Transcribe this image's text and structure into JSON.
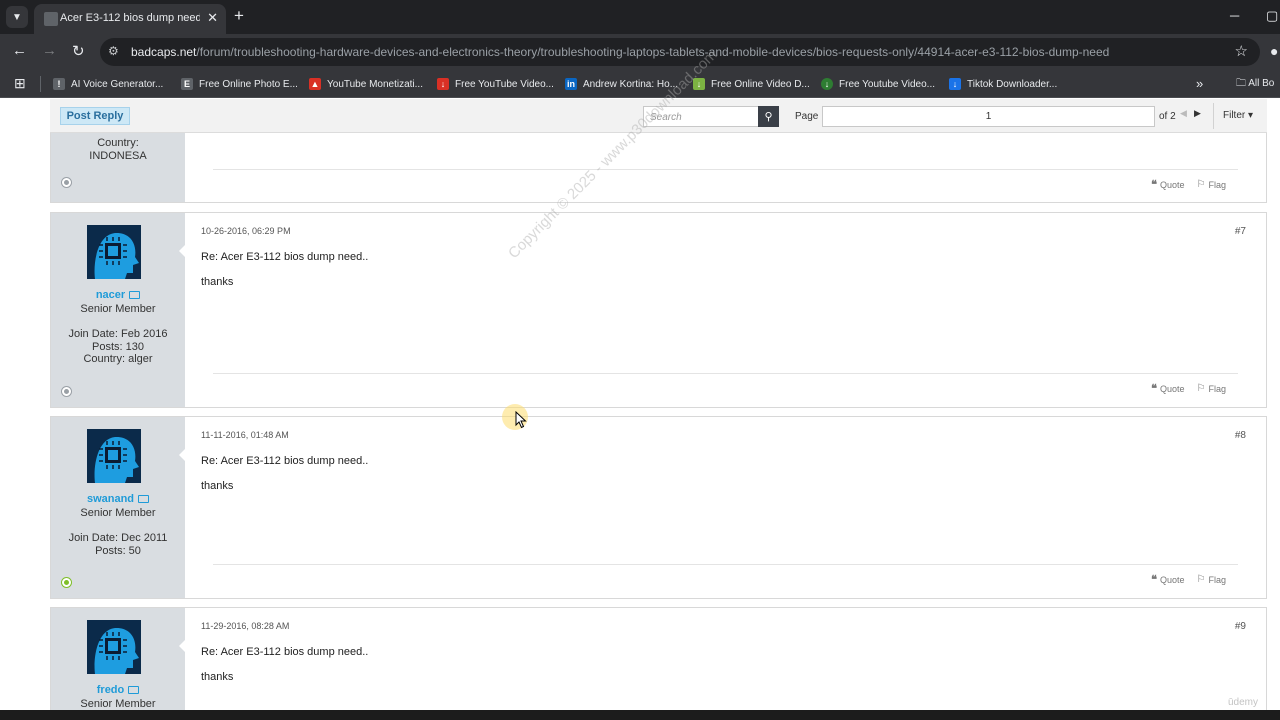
{
  "browser": {
    "tab": {
      "title": "Acer E3-112 bios dump need.."
    },
    "url": {
      "host": "badcaps.net",
      "path": "/forum/troubleshooting-hardware-devices-and-electronics-theory/troubleshooting-laptops-tablets-and-mobile-devices/bios-requests-only/44914-acer-e3-112-bios-dump-need"
    },
    "bookmarks": [
      {
        "label": "AI Voice Generator...",
        "icon": "ai-voice-icon",
        "color": "#5f6368"
      },
      {
        "label": "Free Online Photo E...",
        "icon": "photo-editor-icon",
        "color": "#5f6368"
      },
      {
        "label": "YouTube Monetizati...",
        "icon": "youtube-monetization-icon",
        "color": "#d93025"
      },
      {
        "label": "Free YouTube Video...",
        "icon": "youtube-download-icon",
        "color": "#d93025"
      },
      {
        "label": "Andrew Kortina: Ho...",
        "icon": "linkedin-icon",
        "color": "#0a66c2"
      },
      {
        "label": "Free Online Video D...",
        "icon": "download-arrow-icon",
        "color": "#7cb342"
      },
      {
        "label": "Free Youtube Video...",
        "icon": "video-downloader-icon",
        "color": "#2e7d32"
      },
      {
        "label": "Tiktok Downloader...",
        "icon": "tiktok-downloader-icon",
        "color": "#1a73e8"
      }
    ],
    "all_bookmarks_label": "All Bo"
  },
  "forum_bar": {
    "post_reply_label": "Post Reply",
    "search_placeholder": "Search",
    "page_label": "Page",
    "page_value": "1",
    "page_of": "of 2",
    "filter_label": "Filter"
  },
  "prev_post": {
    "info_line": "Country:",
    "country": "INDONESA",
    "quote_label": "Quote",
    "flag_label": "Flag"
  },
  "posts": [
    {
      "username": "nacer",
      "rank": "Senior Member",
      "join_date": "Join Date: Feb 2016",
      "posts": "Posts: 130",
      "country": "Country: alger",
      "date": "10-26-2016, 06:29 PM",
      "number": "#7",
      "title": "Re: Acer E3-112 bios dump need..",
      "text": "thanks",
      "quote_label": "Quote",
      "flag_label": "Flag",
      "online": false
    },
    {
      "username": "swanand",
      "rank": "Senior Member",
      "join_date": "Join Date: Dec 2011",
      "posts": "Posts: 50",
      "country": "",
      "date": "11-11-2016, 01:48 AM",
      "number": "#8",
      "title": "Re: Acer E3-112 bios dump need..",
      "text": "thanks",
      "quote_label": "Quote",
      "flag_label": "Flag",
      "online": true
    },
    {
      "username": "fredo",
      "rank": "Senior Member",
      "date": "11-29-2016, 08:28 AM",
      "number": "#9",
      "title": "Re: Acer E3-112 bios dump need..",
      "text": "thanks"
    }
  ],
  "overlay": {
    "watermark": "Copyright © 2025 - www.p30download.com",
    "brand": "ūdemy"
  },
  "colors": {
    "accent": "#1f9bd8",
    "userbox_bg": "#d9dde1",
    "online": "#7fbf2a",
    "offline": "#9aa0a6"
  }
}
